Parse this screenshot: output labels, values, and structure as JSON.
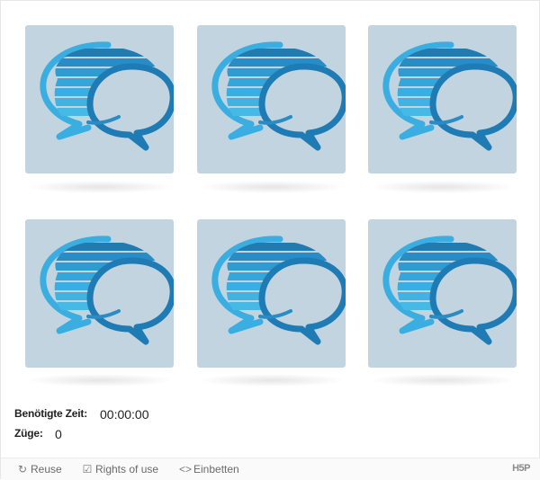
{
  "cards": [
    {
      "icon": "speech-bubbles-icon"
    },
    {
      "icon": "speech-bubbles-icon"
    },
    {
      "icon": "speech-bubbles-icon"
    },
    {
      "icon": "speech-bubbles-icon"
    },
    {
      "icon": "speech-bubbles-icon"
    },
    {
      "icon": "speech-bubbles-icon"
    }
  ],
  "stats": {
    "time_label": "Benötigte Zeit:",
    "time_value": "00:00:00",
    "moves_label": "Züge:",
    "moves_value": "0"
  },
  "footer": {
    "reuse_label": "Reuse",
    "rights_label": "Rights of use",
    "embed_label": "Einbetten",
    "logo": "H5P"
  },
  "colors": {
    "card_bg": "#c3d4e1",
    "bubble_light": "#3aaee0",
    "bubble_dark": "#1f7bb3"
  }
}
